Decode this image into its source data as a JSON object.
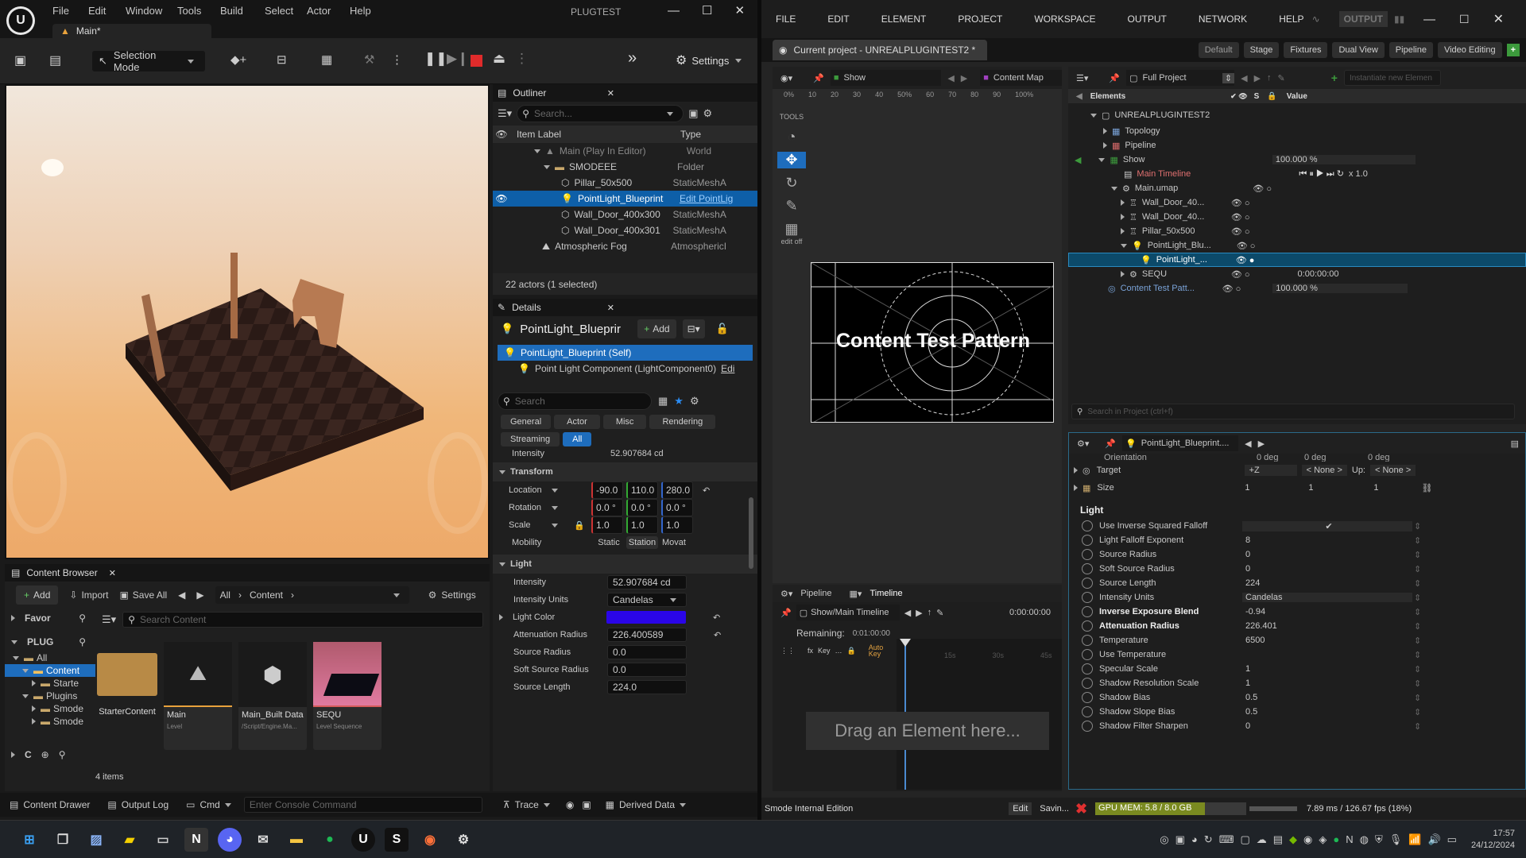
{
  "ue": {
    "menu": [
      "File",
      "Edit",
      "Window",
      "Tools",
      "Build",
      "Select",
      "Actor",
      "Help"
    ],
    "project_title": "PLUGTEST",
    "level_tab": "Main*",
    "selection_mode": "Selection Mode",
    "settings": "Settings",
    "outliner": {
      "title": "Outliner",
      "search_placeholder": "Search...",
      "col_label": "Item Label",
      "col_type": "Type",
      "rows": [
        {
          "label": "Main (Play In Editor)",
          "type": "World"
        },
        {
          "label": "SMODEEE",
          "type": "Folder"
        },
        {
          "label": "Pillar_50x500",
          "type": "StaticMeshA"
        },
        {
          "label": "PointLight_Blueprint",
          "type": "Edit PointLig"
        },
        {
          "label": "Wall_Door_400x300",
          "type": "StaticMeshA"
        },
        {
          "label": "Wall_Door_400x301",
          "type": "StaticMeshA"
        },
        {
          "label": "Atmospheric Fog",
          "type": "AtmosphericI"
        }
      ],
      "status": "22 actors (1 selected)"
    },
    "details": {
      "title": "Details",
      "actor_name": "PointLight_Blueprir",
      "add": "Add",
      "self_row": "PointLight_Blueprint (Self)",
      "component_row": "Point Light Component (LightComponent0)",
      "component_edit": "Edi",
      "search_placeholder": "Search",
      "filters": [
        "General",
        "Actor",
        "Misc",
        "Rendering",
        "Streaming",
        "All"
      ],
      "cut_label": "Intensity",
      "cut_value": "52.907684 cd",
      "transform_header": "Transform",
      "location_label": "Location",
      "location": [
        "-90.0",
        "110.0",
        "280.0"
      ],
      "rotation_label": "Rotation",
      "rotation": [
        "0.0 °",
        "0.0 °",
        "0.0 °"
      ],
      "scale_label": "Scale",
      "scale": [
        "1.0",
        "1.0",
        "1.0"
      ],
      "mobility_label": "Mobility",
      "mobility": [
        "Static",
        "Station",
        "Movat"
      ],
      "light_header": "Light",
      "intensity_label": "Intensity",
      "intensity": "52.907684 cd",
      "units_label": "Intensity Units",
      "units": "Candelas",
      "light_color_label": "Light Color",
      "light_color": "#2a05e8",
      "atten_label": "Attenuation Radius",
      "atten": "226.400589",
      "source_radius_label": "Source Radius",
      "source_radius": "0.0",
      "soft_source_label": "Soft Source Radius",
      "soft_source": "0.0",
      "source_length_label": "Source Length",
      "source_length": "224.0"
    },
    "content_browser": {
      "title": "Content Browser",
      "add": "Add",
      "import": "Import",
      "save_all": "Save All",
      "path_all": "All",
      "path_content": "Content",
      "settings": "Settings",
      "favorites": "Favor",
      "plug": "PLUG",
      "tree": [
        "All",
        "Content",
        "Starte",
        "Plugins",
        "Smode",
        "Smode"
      ],
      "c_label": "C",
      "search_placeholder": "Search Content",
      "items": [
        {
          "name": "StarterContent",
          "type": ""
        },
        {
          "name": "Main",
          "type": "Level"
        },
        {
          "name": "Main_Built Data",
          "type": "/Script/Engine.Ma..."
        },
        {
          "name": "SEQU",
          "type": "Level Sequence"
        }
      ],
      "count": "4 items"
    },
    "bottom": {
      "content_drawer": "Content Drawer",
      "output_log": "Output Log",
      "cmd": "Cmd",
      "console_placeholder": "Enter Console Command",
      "trace": "Trace",
      "derived": "Derived Data"
    }
  },
  "smode": {
    "menu": [
      "FILE",
      "EDIT",
      "ELEMENT",
      "PROJECT",
      "WORKSPACE",
      "OUTPUT",
      "NETWORK",
      "HELP"
    ],
    "output_btn": "OUTPUT",
    "project_tab": "Current project - UNREALPLUGINTEST2 *",
    "layouts": [
      "Default",
      "Stage",
      "Fixtures",
      "Dual View",
      "Pipeline",
      "Video Editing"
    ],
    "viewport": {
      "show": "Show",
      "content_map": "Content Map",
      "ruler": [
        "0%",
        "10",
        "20",
        "30",
        "40",
        "50%",
        "60",
        "70",
        "80",
        "90",
        "100%"
      ],
      "tools": "TOOLS",
      "edit_off": "edit off",
      "pattern_title": "Content Test Pattern"
    },
    "tree": {
      "full_project": "Full Project",
      "instantiate_placeholder": "Instantiate new Elemen",
      "col_elements": "Elements",
      "col_s": "S",
      "col_value": "Value",
      "rows": [
        {
          "label": "UNREALPLUGINTEST2",
          "value": ""
        },
        {
          "label": "Topology",
          "value": ""
        },
        {
          "label": "Pipeline",
          "value": ""
        },
        {
          "label": "Show",
          "value": "100.000 %"
        },
        {
          "label": "Main Timeline",
          "value": "x 1.0"
        },
        {
          "label": "Main.umap",
          "value": ""
        },
        {
          "label": "Wall_Door_40...",
          "value": ""
        },
        {
          "label": "Wall_Door_40...",
          "value": ""
        },
        {
          "label": "Pillar_50x500",
          "value": ""
        },
        {
          "label": "PointLight_Blu...",
          "value": ""
        },
        {
          "label": "PointLight_...",
          "value": ""
        },
        {
          "label": "SEQU",
          "value": "0:00:00:00"
        },
        {
          "label": "Content Test Patt...",
          "value": "100.000 %"
        }
      ],
      "search_placeholder": "Search in Project (ctrl+f)"
    },
    "inspector": {
      "title": "PointLight_Blueprint....",
      "cut_label": "Orientation",
      "cut_values": [
        "0 deg",
        "0 deg",
        "0 deg"
      ],
      "target_label": "Target",
      "target_axis": "+Z",
      "target_none": "< None >",
      "up_label": "Up:",
      "up_none": "< None >",
      "size_label": "Size",
      "size": [
        "1",
        "1",
        "1"
      ],
      "section": "Light",
      "props": [
        {
          "label": "Use Inverse Squared Falloff",
          "value": "✔",
          "bold": false
        },
        {
          "label": "Light Falloff Exponent",
          "value": "8",
          "bold": false
        },
        {
          "label": "Source Radius",
          "value": "0",
          "bold": false
        },
        {
          "label": "Soft Source Radius",
          "value": "0",
          "bold": false
        },
        {
          "label": "Source Length",
          "value": "224",
          "bold": false
        },
        {
          "label": "Intensity Units",
          "value": "Candelas",
          "bold": false
        },
        {
          "label": "Inverse Exposure Blend",
          "value": "-0.94",
          "bold": true
        },
        {
          "label": "Attenuation Radius",
          "value": "226.401",
          "bold": true
        },
        {
          "label": "Temperature",
          "value": "6500",
          "bold": false
        },
        {
          "label": "Use Temperature",
          "value": "",
          "bold": false
        },
        {
          "label": "Specular Scale",
          "value": "1",
          "bold": false
        },
        {
          "label": "Shadow Resolution Scale",
          "value": "1",
          "bold": false
        },
        {
          "label": "Shadow Bias",
          "value": "0.5",
          "bold": false
        },
        {
          "label": "Shadow Slope Bias",
          "value": "0.5",
          "bold": false
        },
        {
          "label": "Shadow Filter Sharpen",
          "value": "0",
          "bold": false
        }
      ]
    },
    "timeline": {
      "tab_pipeline": "Pipeline",
      "tab_timeline": "Timeline",
      "path": "Show/Main Timeline",
      "time": "0:00:00:00",
      "remaining_label": "Remaining:",
      "remaining": "0:01:00:00",
      "fx": "fx",
      "key": "Key",
      "auto_key": "Auto Key",
      "ticks": [
        "15s",
        "30s",
        "45s"
      ],
      "drag_hint": "Drag an Element here..."
    },
    "status": {
      "edition": "Smode Internal Edition",
      "edit": "Edit",
      "saving": "Savin...",
      "gpu": "GPU MEM: 5.8 / 8.0 GB",
      "gpu_fraction": 0.725,
      "fps": "7.89 ms / 126.67 fps (18%)"
    }
  },
  "taskbar": {
    "time": "17:57",
    "date": "24/12/2024"
  }
}
